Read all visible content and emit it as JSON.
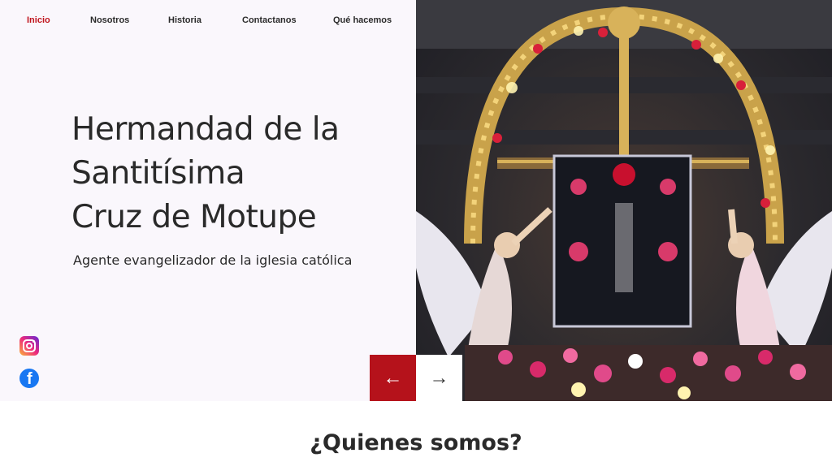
{
  "nav": {
    "items": [
      {
        "label": "Inicio",
        "active": true
      },
      {
        "label": "Nosotros",
        "active": false
      },
      {
        "label": "Historia",
        "active": false
      },
      {
        "label": "Contactanos",
        "active": false
      },
      {
        "label": "Qué hacemos",
        "active": false
      }
    ]
  },
  "hero": {
    "title_lines": [
      "Hermandad de la",
      "Santitísima",
      "Cruz de Motupe"
    ],
    "subtitle": "Agente evangelizador de la iglesia católica",
    "image_alt": "Sma. Cruz de Motupe procession float with angels and flowers"
  },
  "social": {
    "instagram_icon": "instagram-icon",
    "facebook_icon": "facebook-icon"
  },
  "carousel": {
    "prev_label": "←",
    "next_label": "→"
  },
  "about": {
    "title": "¿Quienes somos?"
  },
  "colors": {
    "accent": "#c0151d",
    "prev_button": "#b5121b"
  }
}
